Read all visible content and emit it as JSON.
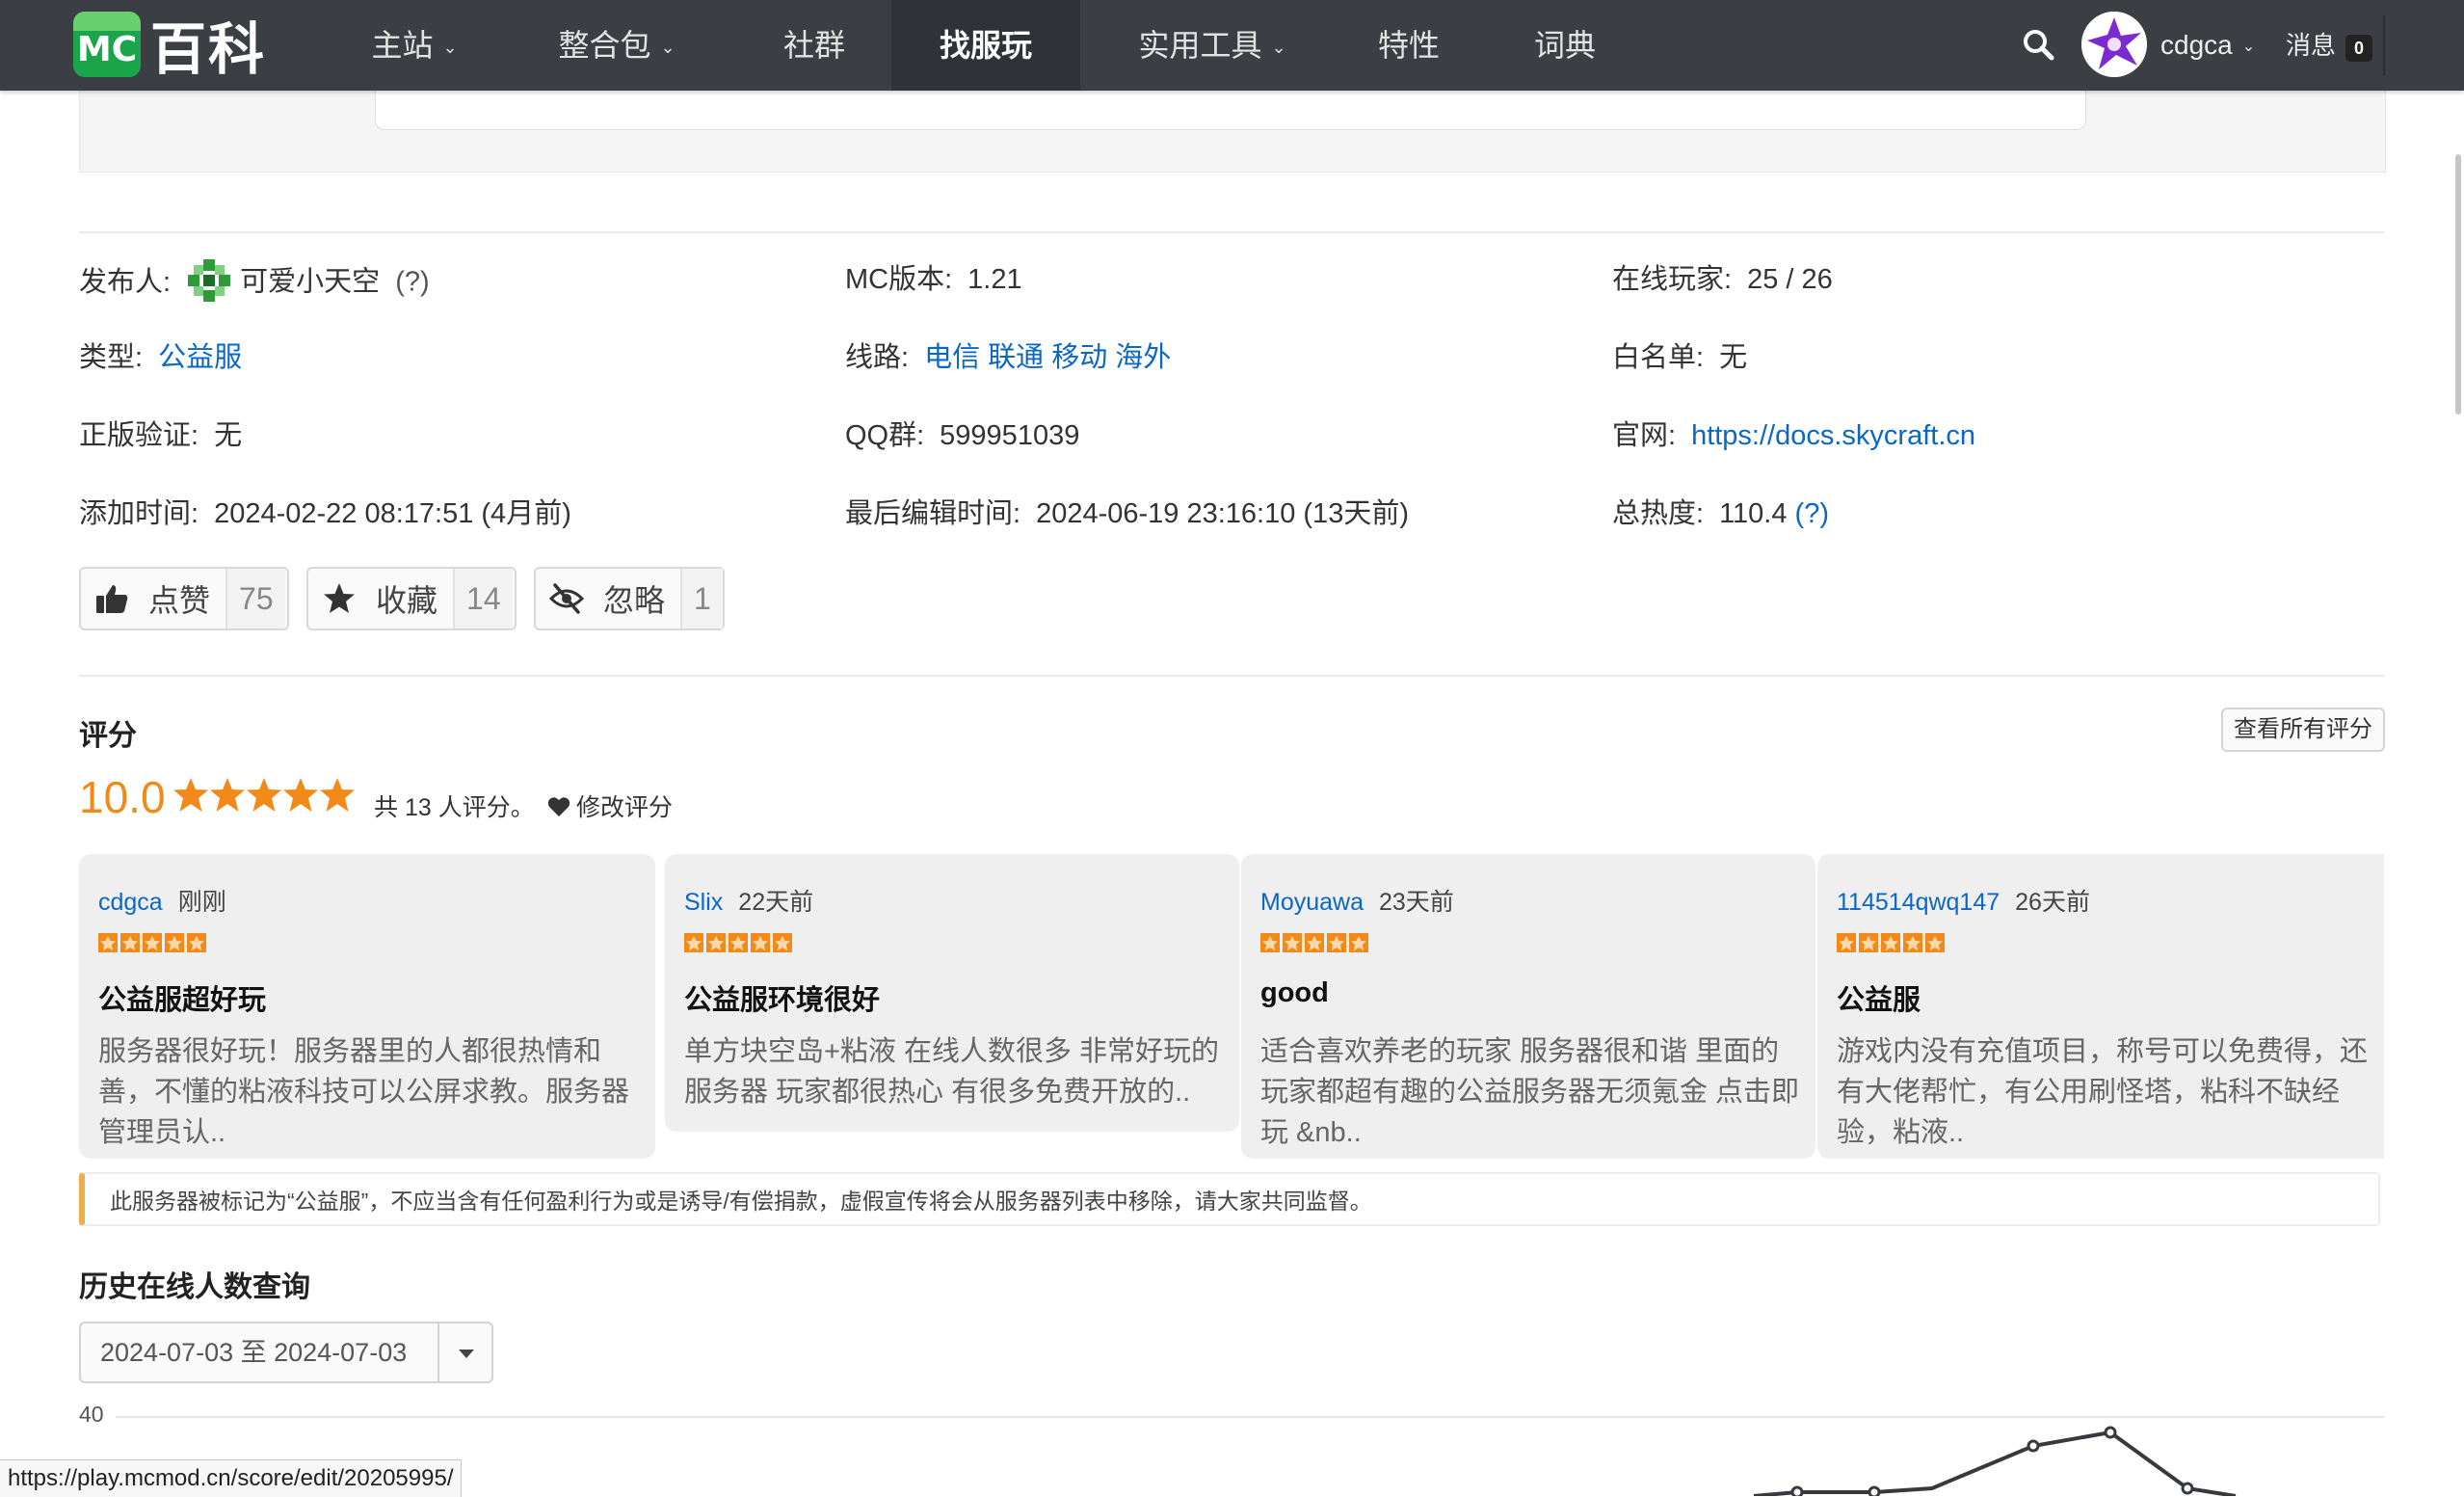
{
  "nav": {
    "logo_mc": "MC",
    "logo_text": "百科",
    "items": [
      {
        "label": "主站",
        "caret": true
      },
      {
        "label": "整合包",
        "caret": true
      },
      {
        "label": "社群",
        "caret": false
      },
      {
        "label": "找服玩",
        "caret": false,
        "active": true
      },
      {
        "label": "实用工具",
        "caret": true
      },
      {
        "label": "特性",
        "caret": false
      },
      {
        "label": "词典",
        "caret": false
      }
    ],
    "user": "cdgca",
    "messages_label": "消息",
    "messages_count": "0"
  },
  "info": {
    "publisher_label": "发布人:",
    "publisher": "可爱小天空",
    "publisher_help": "(?)",
    "mc_version_label": "MC版本:",
    "mc_version": "1.21",
    "online_label": "在线玩家:",
    "online": "25 / 26",
    "type_label": "类型:",
    "type": "公益服",
    "route_label": "线路:",
    "routes": [
      "电信",
      "联通",
      "移动",
      "海外"
    ],
    "whitelist_label": "白名单:",
    "whitelist": "无",
    "auth_label": "正版验证:",
    "auth": "无",
    "qq_label": "QQ群:",
    "qq": "599951039",
    "site_label": "官网:",
    "site": "https://docs.skycraft.cn",
    "added_label": "添加时间:",
    "added": "2024-02-22 08:17:51 (4月前)",
    "edited_label": "最后编辑时间:",
    "edited": "2024-06-19 23:16:10 (13天前)",
    "heat_label": "总热度:",
    "heat": "110.4",
    "heat_help": "(?)"
  },
  "actions": [
    {
      "label": "点赞",
      "count": "75",
      "icon": "thumbs-up-icon"
    },
    {
      "label": "收藏",
      "count": "14",
      "icon": "star-icon"
    },
    {
      "label": "忽略",
      "count": "1",
      "icon": "eye-slash-icon"
    }
  ],
  "rating": {
    "title": "评分",
    "view_all": "查看所有评分",
    "score": "10.0",
    "stars": 5,
    "count_text": "共 13 人评分。",
    "edit_label": "修改评分",
    "accent": "#f28a19"
  },
  "reviews": [
    {
      "user": "cdgca",
      "time": "刚刚",
      "stars": 5,
      "title": "公益服超好玩",
      "body": "服务器很好玩！服务器里的人都很热情和善，不懂的粘液科技可以公屏求教。服务器管理员认.."
    },
    {
      "user": "Slix",
      "time": "22天前",
      "stars": 5,
      "title": "公益服环境很好",
      "body": "单方块空岛+粘液 在线人数很多 非常好玩的服务器 玩家都很热心  有很多免费开放的.."
    },
    {
      "user": "Moyuawa",
      "time": "23天前",
      "stars": 5,
      "title": "good",
      "body": "适合喜欢养老的玩家 服务器很和谐 里面的玩家都超有趣的公益服务器无须氪金 点击即玩 &nb.."
    },
    {
      "user": "114514qwq147",
      "time": "26天前",
      "stars": 5,
      "title": "公益服",
      "body": "游戏内没有充值项目，称号可以免费得，还有大佬帮忙，有公用刷怪塔，粘科不缺经验，粘液.."
    }
  ],
  "notice": "此服务器被标记为“公益服”，不应当含有任何盈利行为或是诱导/有偿捐款，虚假宣传将会从服务器列表中移除，请大家共同监督。",
  "history": {
    "title": "历史在线人数查询",
    "date_range": "2024-07-03 至 2024-07-03",
    "y_tick": "40"
  },
  "status_url": "https://play.mcmod.cn/score/edit/20205995/"
}
